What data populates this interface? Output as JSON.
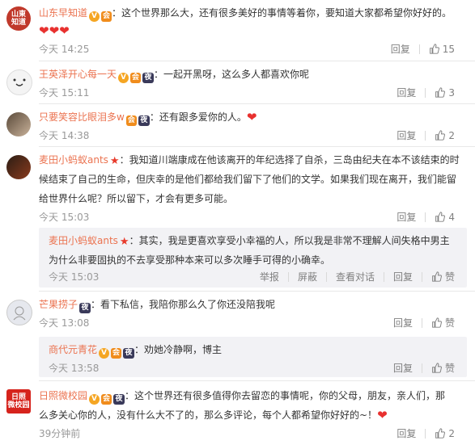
{
  "comments": [
    {
      "user": "山东早知道",
      "avatar_text": "山東\n知道",
      "text": "：这个世界那么大，还有很多美好的事情等着你，要知道大家都希望你好好的。",
      "hearts": "❤❤❤",
      "time": "今天 14:25",
      "reply_label": "回复",
      "like_count": "15"
    },
    {
      "user": "王英泽开心每一天",
      "text": "：一起开黑呀，这么多人都喜欢你呢",
      "time": "今天 15:11",
      "reply_label": "回复",
      "like_count": "3"
    },
    {
      "user": "只要笑容比眼泪多w",
      "text": "：还有跟多爱你的人。",
      "time": "今天 14:38",
      "reply_label": "回复",
      "like_count": "2"
    },
    {
      "user": "麦田小蚂蚁ants",
      "text_1": "：我知道川端康成在他该离开的年纪选择了自杀，三岛由纪夫在本不该结束的时",
      "text_2": "候结束了自己的生命，但庆幸的是他们都给我们留下了他们的文学。如果我们现在离开，我们能留",
      "text_3": "给世界什么呢？所以留下，才会有更多可能。",
      "time": "今天 15:03",
      "reply_label": "回复",
      "like_count": "4",
      "reply": {
        "user": "麦田小蚂蚁ants",
        "text_1": "：其实，我是更喜欢享受小幸福的人，所以我是非常不理解人间失格中男主",
        "text_2": "为什么非要固执的不去享受那种本来可以多次睡手可得的小确幸。",
        "time": "今天 15:03",
        "report_label": "举报",
        "block_label": "屏蔽",
        "view_label": "查看对话",
        "reply_label": "回复",
        "like_label": "赞"
      }
    },
    {
      "user": "芒果捞子",
      "text": "：看下私信，我陪你那么久了你还没陪我呢",
      "time": "今天 13:08",
      "reply_label": "回复",
      "like_label": "赞",
      "reply": {
        "user": "商代元青花",
        "text": "：劝她冷静啊，博主",
        "time": "今天 13:58",
        "reply_label": "回复",
        "like_label": "赞"
      }
    },
    {
      "user": "日照微校园",
      "avatar_text": "日照\n微校园",
      "text_1": "：这个世界还有很多值得你去留恋的事情呢，你的父母，朋友，亲人们，那",
      "text_2": "么多关心你的人，没有什么大不了的，那么多评论，每个人都希望你好好的~！",
      "time": "39分钟前",
      "reply_label": "回复",
      "like_count": "2"
    }
  ],
  "icons": {
    "verified": "V",
    "vip": "会",
    "night": "夜",
    "star": "★",
    "heart": "❤"
  },
  "colors": {
    "username": "#eb7350",
    "time": "#999999",
    "heart": "#e8312f",
    "reply_bg": "#f2f2f5"
  }
}
